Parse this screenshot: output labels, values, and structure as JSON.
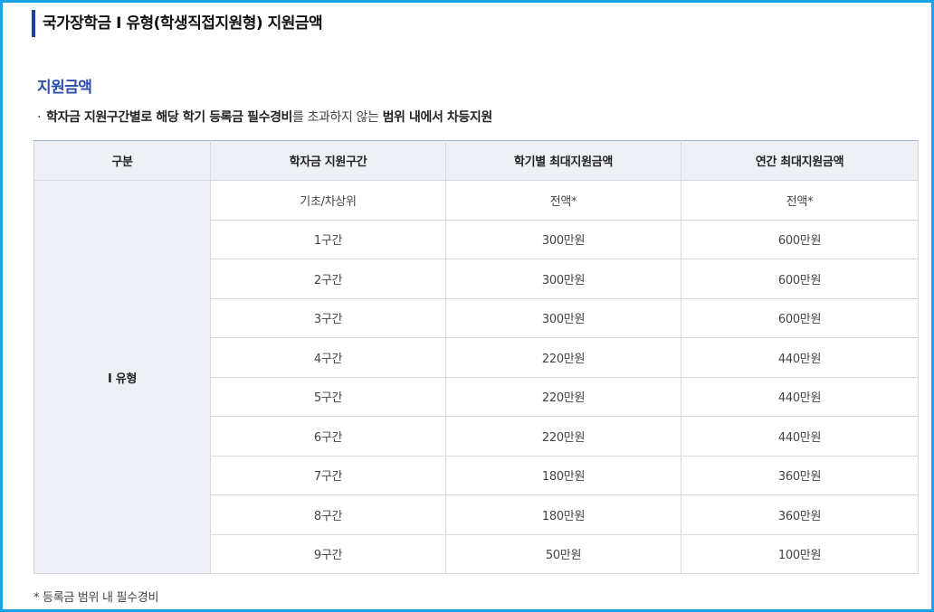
{
  "page_title": "국가장학금 Ⅰ 유형(학생직접지원형) 지원금액",
  "section_title": "지원금액",
  "description": {
    "bullet": "·",
    "part1": "학자금 지원구간별로 해당 학기 등록금 필수경비",
    "part2": "를 초과하지 않는 ",
    "part3": "범위 내에서 차등지원"
  },
  "table": {
    "headers": [
      "구분",
      "학자금 지원구간",
      "학기별 최대지원금액",
      "연간 최대지원금액"
    ],
    "type_label": "Ⅰ 유형",
    "rows": [
      {
        "bracket": "기초/차상위",
        "semester": "전액*",
        "annual": "전액*"
      },
      {
        "bracket": "1구간",
        "semester": "300만원",
        "annual": "600만원"
      },
      {
        "bracket": "2구간",
        "semester": "300만원",
        "annual": "600만원"
      },
      {
        "bracket": "3구간",
        "semester": "300만원",
        "annual": "600만원"
      },
      {
        "bracket": "4구간",
        "semester": "220만원",
        "annual": "440만원"
      },
      {
        "bracket": "5구간",
        "semester": "220만원",
        "annual": "440만원"
      },
      {
        "bracket": "6구간",
        "semester": "220만원",
        "annual": "440만원"
      },
      {
        "bracket": "7구간",
        "semester": "180만원",
        "annual": "360만원"
      },
      {
        "bracket": "8구간",
        "semester": "180만원",
        "annual": "360만원"
      },
      {
        "bracket": "9구간",
        "semester": "50만원",
        "annual": "100만원"
      }
    ]
  },
  "footnote": "* 등록금 범위 내 필수경비",
  "colors": {
    "frame_border": "#1aa3e8",
    "title_bar": "#1f3f9c",
    "section_title": "#2d4faa",
    "header_bg": "#edf1f6"
  }
}
